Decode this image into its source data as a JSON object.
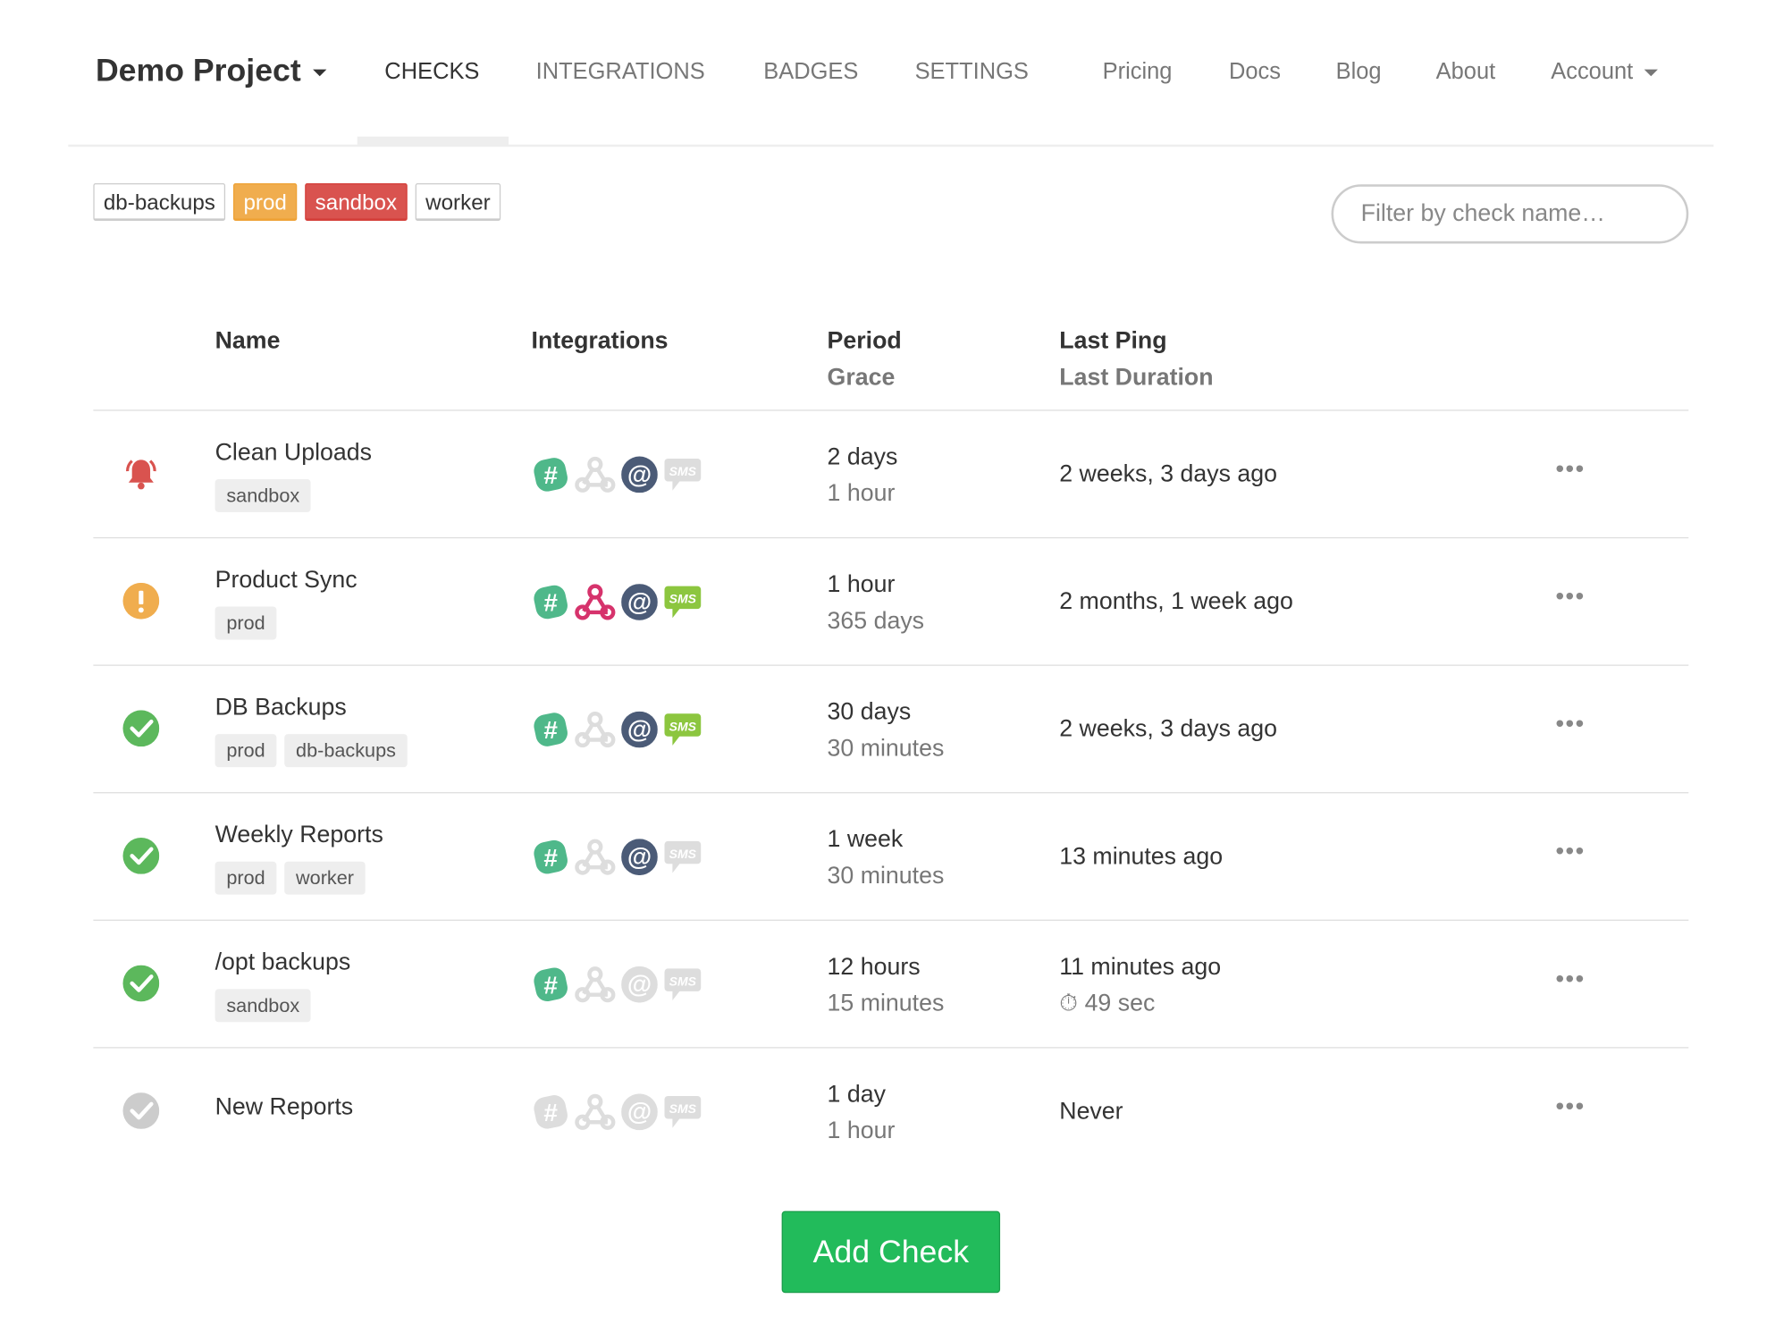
{
  "nav": {
    "project": "Demo Project",
    "tabs": [
      {
        "label": "CHECKS",
        "active": true
      },
      {
        "label": "INTEGRATIONS"
      },
      {
        "label": "BADGES"
      },
      {
        "label": "SETTINGS"
      }
    ],
    "links": [
      "Pricing",
      "Docs",
      "Blog",
      "About"
    ],
    "account": "Account"
  },
  "filter_tags": [
    {
      "label": "db-backups",
      "style": "default"
    },
    {
      "label": "prod",
      "style": "prod"
    },
    {
      "label": "sandbox",
      "style": "sandbox"
    },
    {
      "label": "worker",
      "style": "default"
    }
  ],
  "filter": {
    "placeholder": "Filter by check name…"
  },
  "table": {
    "headers": {
      "name": "Name",
      "integrations": "Integrations",
      "period": "Period",
      "grace": "Grace",
      "last_ping": "Last Ping",
      "last_duration": "Last Duration"
    },
    "rows": [
      {
        "status": "down",
        "name": "Clean Uploads",
        "tags": [
          "sandbox"
        ],
        "integrations": {
          "slack": true,
          "webhook": false,
          "email": true,
          "sms": false
        },
        "period": "2 days",
        "grace": "1 hour",
        "last_ping": "2 weeks, 3 days ago"
      },
      {
        "status": "grace",
        "name": "Product Sync",
        "tags": [
          "prod"
        ],
        "integrations": {
          "slack": true,
          "webhook": true,
          "email": true,
          "sms": true
        },
        "period": "1 hour",
        "grace": "365 days",
        "last_ping": "2 months, 1 week ago"
      },
      {
        "status": "up",
        "name": "DB Backups",
        "tags": [
          "prod",
          "db-backups"
        ],
        "integrations": {
          "slack": true,
          "webhook": false,
          "email": true,
          "sms": true
        },
        "period": "30 days",
        "grace": "30 minutes",
        "last_ping": "2 weeks, 3 days ago"
      },
      {
        "status": "up",
        "name": "Weekly Reports",
        "tags": [
          "prod",
          "worker"
        ],
        "integrations": {
          "slack": true,
          "webhook": false,
          "email": true,
          "sms": false
        },
        "period": "1 week",
        "grace": "30 minutes",
        "last_ping": "13 minutes ago"
      },
      {
        "status": "up",
        "name": "/opt backups",
        "tags": [
          "sandbox"
        ],
        "integrations": {
          "slack": true,
          "webhook": false,
          "email": false,
          "sms": false
        },
        "period": "12 hours",
        "grace": "15 minutes",
        "last_ping": "11 minutes ago",
        "last_duration": "49 sec"
      },
      {
        "status": "new",
        "name": "New Reports",
        "tags": [],
        "integrations": {
          "slack": false,
          "webhook": false,
          "email": false,
          "sms": false
        },
        "period": "1 day",
        "grace": "1 hour",
        "last_ping": "Never"
      }
    ],
    "menu_glyph": "•••",
    "sms_label": "SMS"
  },
  "add_check": "Add Check",
  "colors": {
    "up": "#5cb85c",
    "grace": "#f0ad4e",
    "down": "#d9534f",
    "new": "#ccc",
    "slack": "#4fb88a",
    "webhook": "#d6336c",
    "email": "#4b5b77",
    "sms": "#8cc63f",
    "off": "#ddd",
    "accent": "#22bb5b"
  }
}
